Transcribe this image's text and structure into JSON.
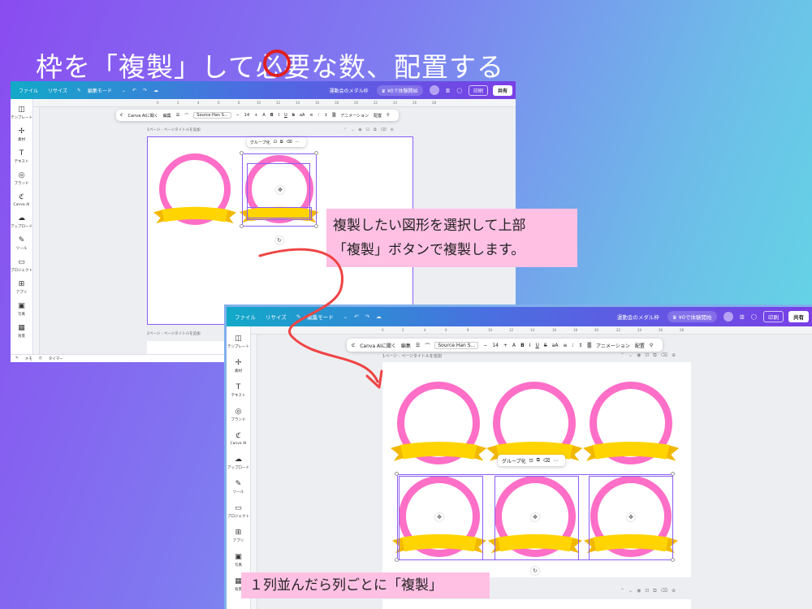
{
  "slide": {
    "title": "枠を「複製」して必要な数、配置する"
  },
  "callouts": {
    "step1_line1": "複製したい図形を選択して上部",
    "step1_line2": "「複製」ボタンで複製します。",
    "step2": "１列並んだら列ごとに「複製」"
  },
  "editor": {
    "menu": {
      "file": "ファイル",
      "resize": "リサイズ",
      "edit_mode": "編集モード"
    },
    "doc_title": "運動会のメダル枠",
    "trial_label": "¥0で体験開始",
    "print_label": "印刷",
    "share_label": "共有",
    "sidebar": [
      {
        "label": "テンプレート",
        "icon": "template-icon"
      },
      {
        "label": "素材",
        "icon": "elements-icon"
      },
      {
        "label": "テキスト",
        "icon": "text-icon"
      },
      {
        "label": "ブランド",
        "icon": "brand-icon"
      },
      {
        "label": "Canva AI",
        "icon": "ai-icon"
      },
      {
        "label": "アップロード",
        "icon": "upload-icon"
      },
      {
        "label": "ツール",
        "icon": "tools-icon"
      },
      {
        "label": "プロジェクト",
        "icon": "folder-icon"
      },
      {
        "label": "アプリ",
        "icon": "apps-icon"
      },
      {
        "label": "写真",
        "icon": "photo-icon"
      },
      {
        "label": "背景",
        "icon": "background-icon"
      }
    ],
    "ruler_ticks": [
      "0",
      "2",
      "4",
      "6",
      "8",
      "10",
      "12",
      "14",
      "16",
      "18",
      "20",
      "22",
      "24",
      "26",
      "28"
    ],
    "ctx_toolbar": {
      "canva_ai": "Canva AIに聞く",
      "edit": "編集",
      "font": "Source Han S...",
      "font_size": "14",
      "animation": "アニメーション",
      "arrange": "配置",
      "bold": "B",
      "italic": "I",
      "underline": "U",
      "strike": "S",
      "case": "aA",
      "minus": "−"
    },
    "page1_label": "1ページ - ページタイトルを追加",
    "page2_label": "2ページ - ページタイトルを追加",
    "group_label": "グループ化",
    "bottom": {
      "notes": "メモ",
      "timer": "タイマー"
    }
  },
  "colors": {
    "ring": "#ff6ec7",
    "ribbon": "#ffd400",
    "selection": "#8b5cf6",
    "highlight": "#e02020",
    "callout_bg": "#ffc0e4"
  }
}
